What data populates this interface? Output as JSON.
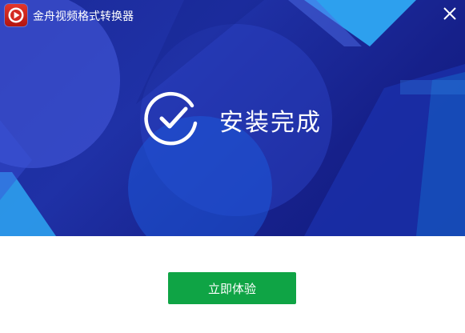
{
  "window": {
    "title": "金舟视频格式转换器",
    "app_icon": "play-logo-icon",
    "close_icon": "close-icon"
  },
  "install": {
    "status_icon": "check-circle-icon",
    "status_text": "安装完成"
  },
  "actions": {
    "primary_label": "立即体验"
  },
  "colors": {
    "hero_background": "#1b2a9a",
    "accent_light_blue": "#2ea6f2",
    "button_green": "#0fa445",
    "app_icon_red": "#d42a22"
  }
}
